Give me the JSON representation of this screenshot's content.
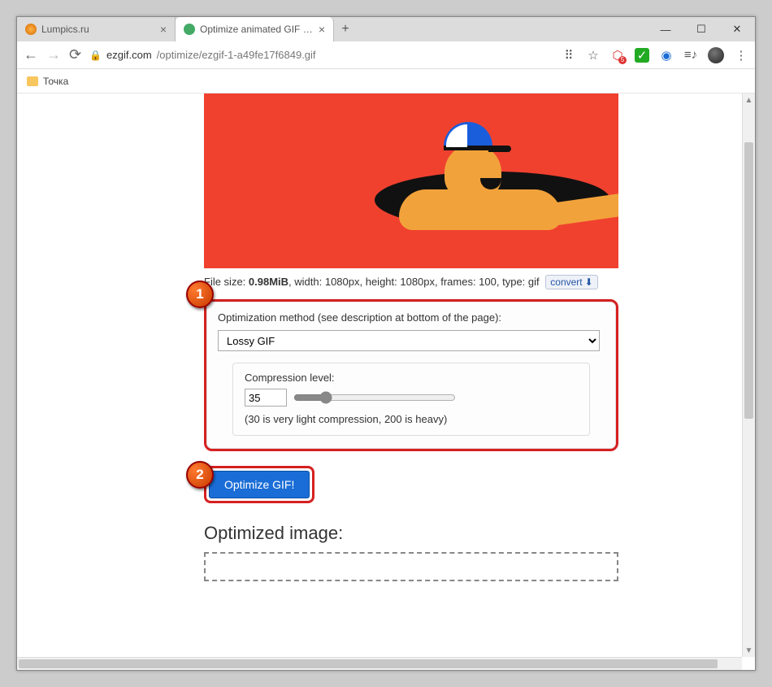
{
  "tabs": [
    {
      "title": "Lumpics.ru"
    },
    {
      "title": "Optimize animated GIF - gif-ma…"
    }
  ],
  "url": {
    "host": "ezgif.com",
    "path": "/optimize/ezgif-1-a49fe17f6849.gif"
  },
  "bookmarks": {
    "item1": "Точка"
  },
  "file_info": {
    "prefix": "File size: ",
    "size": "0.98MiB",
    "mid": ", width: 1080px, height: 1080px, frames: 100, type: gif",
    "convert": "convert"
  },
  "opt": {
    "method_label": "Optimization method (see description at bottom of the page):",
    "method_value": "Lossy GIF",
    "comp_label": "Compression level:",
    "comp_value": "35",
    "comp_note": "(30 is very light compression, 200 is heavy)"
  },
  "actions": {
    "optimize": "Optimize GIF!"
  },
  "result": {
    "heading": "Optimized image:"
  },
  "anno": {
    "one": "1",
    "two": "2"
  },
  "toolbar_badge": {
    "five": "5"
  }
}
